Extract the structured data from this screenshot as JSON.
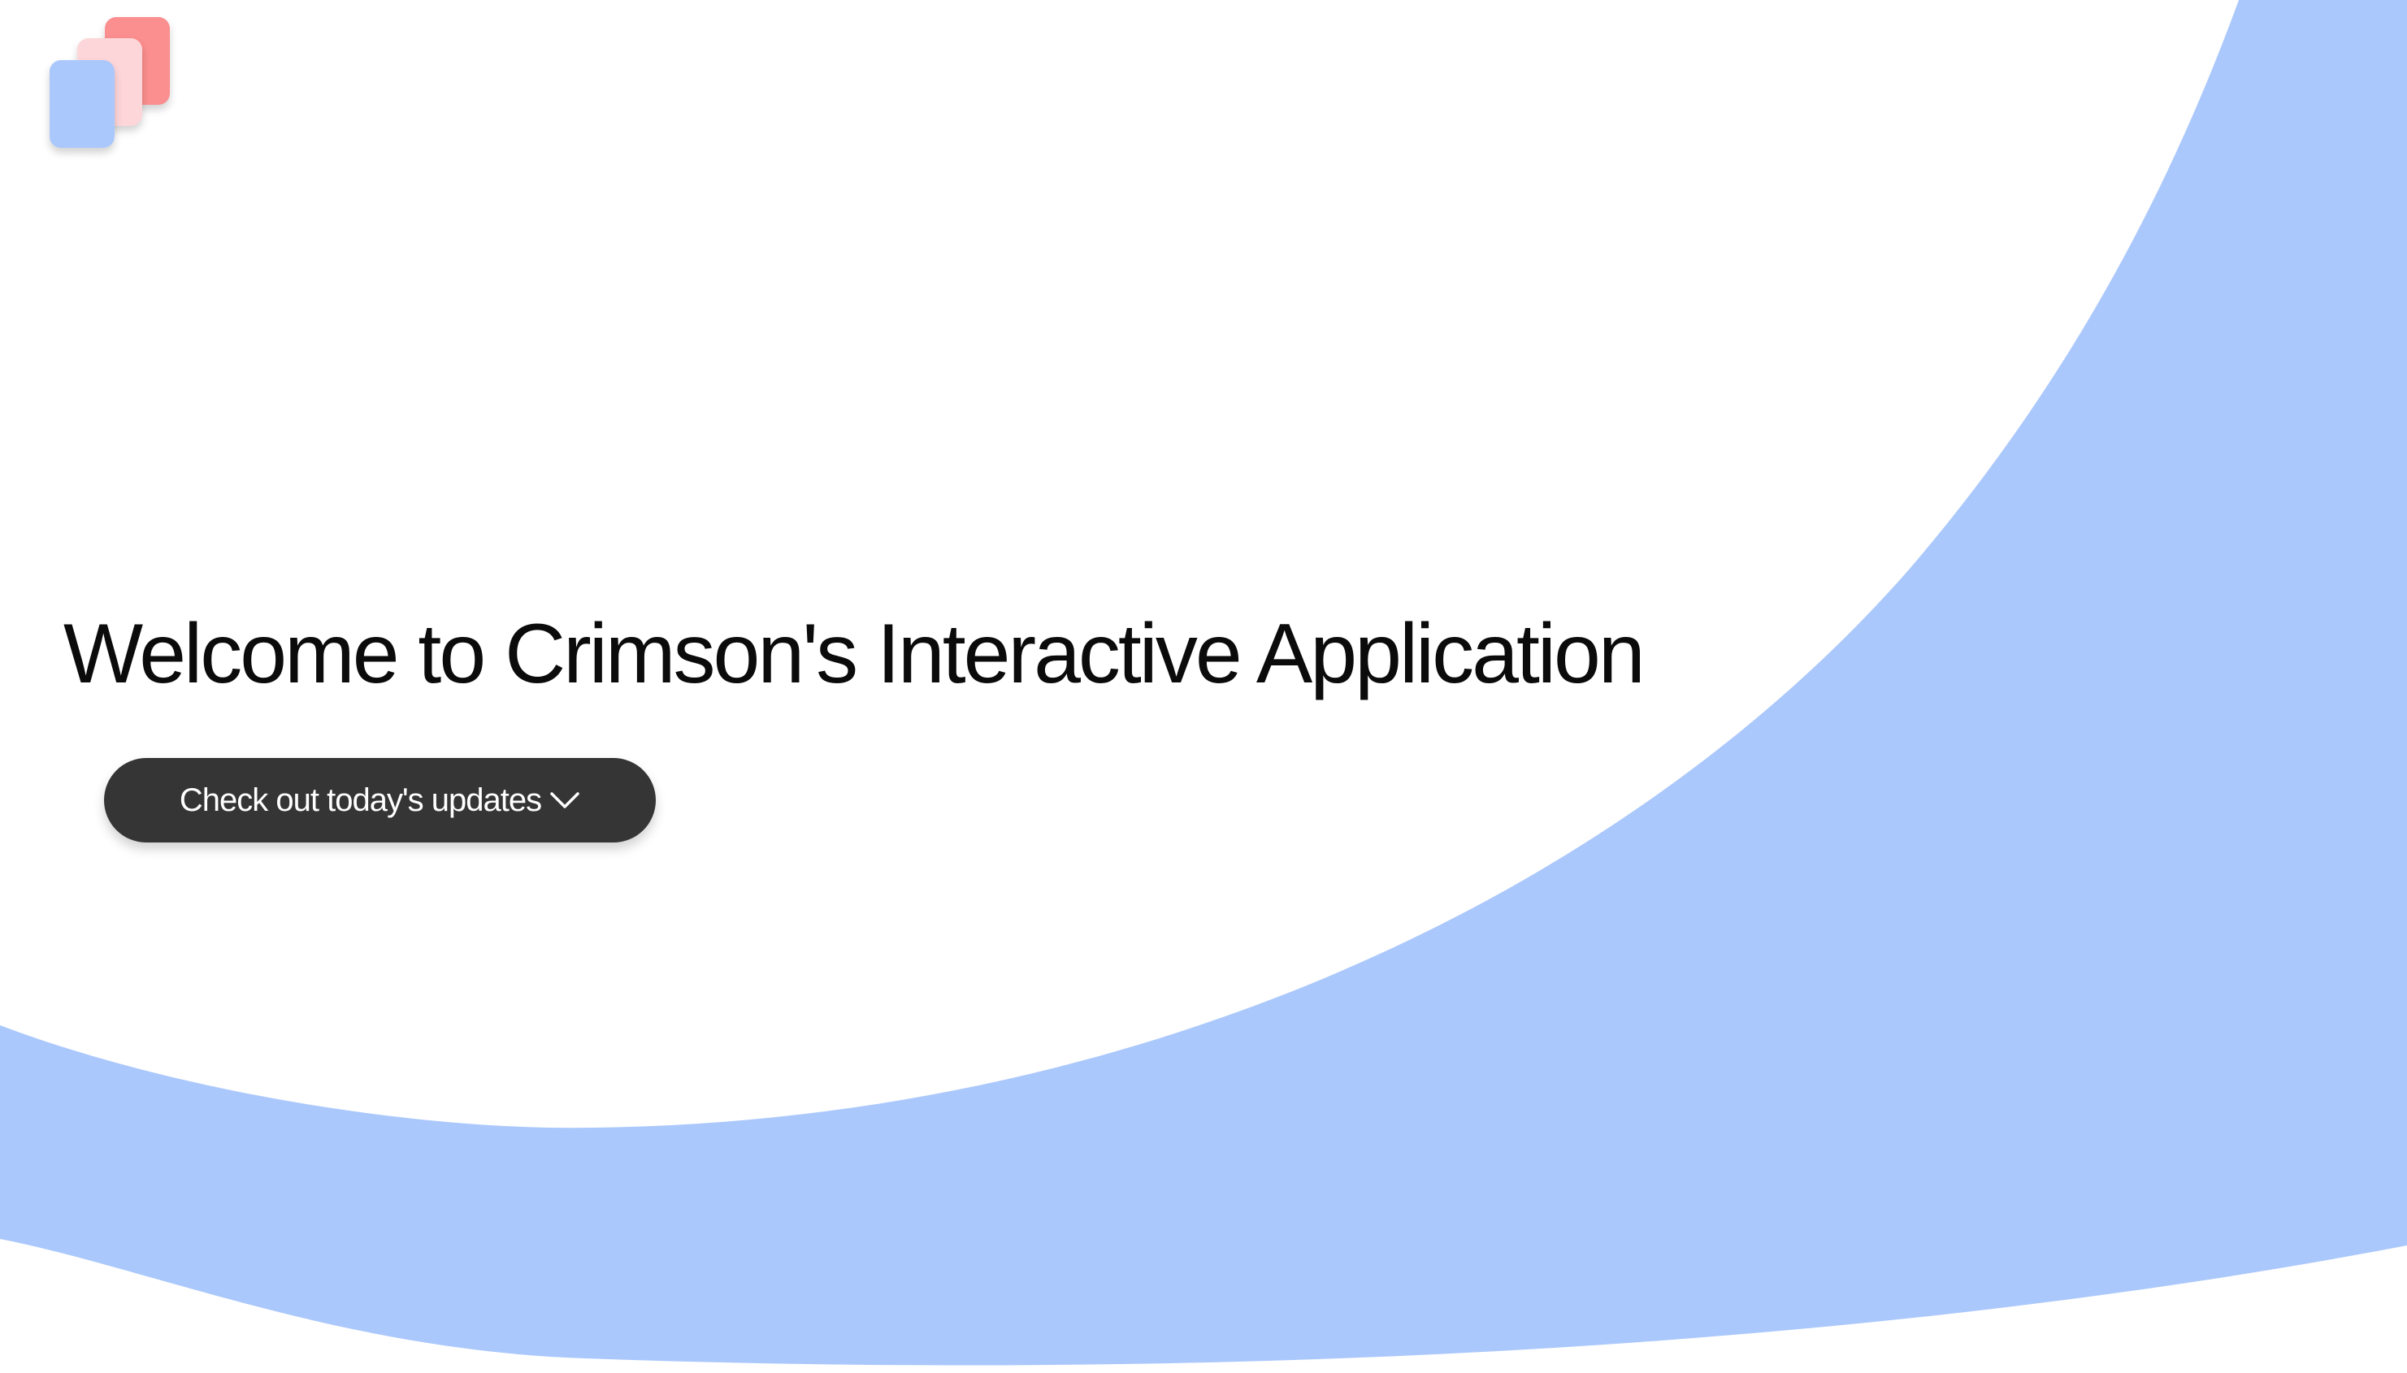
{
  "colors": {
    "page_background": "#ffffff",
    "accent_blue": "#abc8fc",
    "button_background": "#353535",
    "button_text": "#ffffff",
    "title_text": "#0b0b0b",
    "logo_red": "#fb8e8e",
    "logo_pink": "#fdd6d9",
    "logo_blue": "#abc8fc"
  },
  "logo": {
    "icon": "stacked-cards-logo-icon"
  },
  "hero": {
    "title": "Welcome to Crimson's Interactive Application"
  },
  "cta": {
    "label": "Check out today's updates",
    "icon": "chevron-down-icon"
  }
}
